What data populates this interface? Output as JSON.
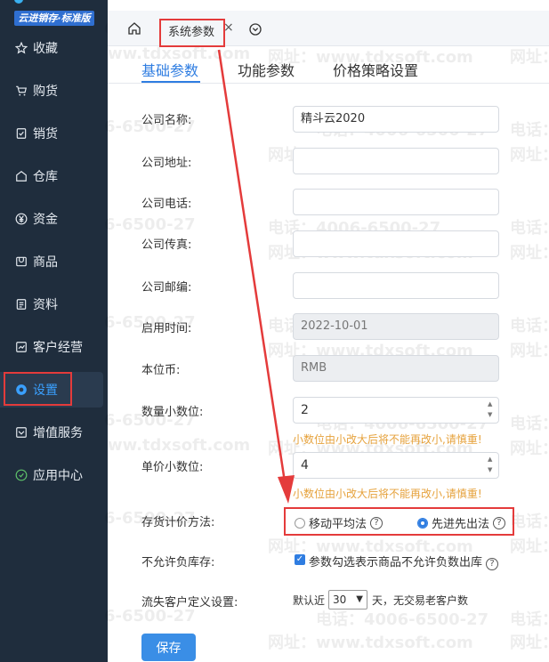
{
  "sidebar": {
    "brand_top": "",
    "badge": "云进销存·标准版",
    "items": [
      {
        "label": "收藏",
        "icon": "star-icon"
      },
      {
        "label": "购货",
        "icon": "cart-icon"
      },
      {
        "label": "销货",
        "icon": "sales-icon"
      },
      {
        "label": "仓库",
        "icon": "warehouse-icon"
      },
      {
        "label": "资金",
        "icon": "yen-icon"
      },
      {
        "label": "商品",
        "icon": "goods-icon"
      },
      {
        "label": "资料",
        "icon": "document-icon"
      },
      {
        "label": "客户经营",
        "icon": "customer-icon"
      },
      {
        "label": "设置",
        "icon": "settings-icon"
      },
      {
        "label": "增值服务",
        "icon": "service-icon"
      },
      {
        "label": "应用中心",
        "icon": "app-icon"
      }
    ]
  },
  "tabs": {
    "active_label": "系统参数",
    "close": "×"
  },
  "subtabs": [
    "基础参数",
    "功能参数",
    "价格策略设置"
  ],
  "form": {
    "company_name_label": "公司名称:",
    "company_name_value": "精斗云2020",
    "company_address_label": "公司地址:",
    "company_phone_label": "公司电话:",
    "company_fax_label": "公司传真:",
    "company_postcode_label": "公司邮编:",
    "start_date_label": "启用时间:",
    "start_date_value": "2022-10-01",
    "currency_label": "本位币:",
    "currency_value": "RMB",
    "qty_decimals_label": "数量小数位:",
    "qty_decimals_value": "2",
    "price_decimals_label": "单价小数位:",
    "price_decimals_value": "4",
    "decimal_warning": "小数位由小改大后将不能再改小,请慎重!",
    "costing_label": "存货计价方法:",
    "costing_option_1": "移动平均法",
    "costing_option_2": "先进先出法",
    "negative_stock_label": "不允许负库存:",
    "negative_stock_text": "参数勾选表示商品不允许负数出库",
    "lost_customer_label": "流失客户定义设置:",
    "lost_customer_prefix": "默认近",
    "lost_customer_days": "30",
    "lost_customer_suffix": "天，无交易老客户数",
    "help": "?"
  },
  "save_label": "保存",
  "watermark": {
    "phone": "电话：4006-6500-27",
    "site": "网址：www.tdxsoft.com",
    "phone_partial": "6-6500-27",
    "site_partial": "ww.tdxsoft.com",
    "phone_tail": "电话：",
    "site_tail": "网址："
  },
  "colors": {
    "sidebar_bg": "#1f2d3d",
    "accent": "#2f7de1",
    "highlight": "#e43b3b",
    "warning": "#e6a23c"
  }
}
